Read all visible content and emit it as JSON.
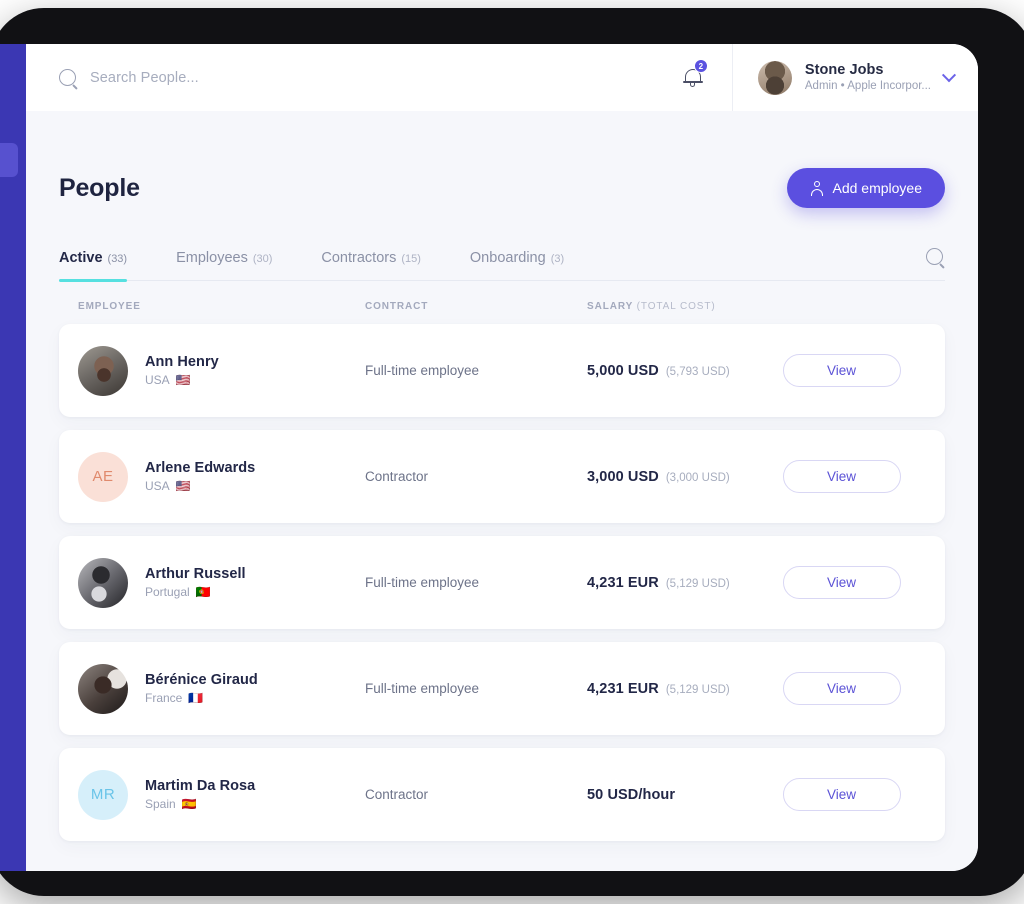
{
  "topbar": {
    "search": {
      "placeholder": "Search People...",
      "value": "",
      "icon": "search-icon"
    },
    "notifications": {
      "icon": "bell-icon",
      "badge": "2"
    },
    "user": {
      "name": "Stone Jobs",
      "subtitle": "Admin  •  Apple Incorpor...",
      "avatar": "user-avatar",
      "chevron": "chevron-down-icon"
    }
  },
  "page": {
    "title": "People",
    "add_employee_label": "Add employee",
    "add_employee_icon": "person-add-icon",
    "accent_purple": "#5b4fe0",
    "accent_teal": "#56e0e0"
  },
  "tabs": {
    "search_icon": "search-icon",
    "items": [
      {
        "label": "Active",
        "count": "(33)",
        "active": true
      },
      {
        "label": "Employees",
        "count": "(30)",
        "active": false
      },
      {
        "label": "Contractors",
        "count": "(15)",
        "active": false
      },
      {
        "label": "Onboarding",
        "count": "(3)",
        "active": false
      }
    ]
  },
  "table": {
    "headers": {
      "employee": "EMPLOYEE",
      "contract": "CONTRACT",
      "salary": "SALARY",
      "salary_sub": "(TOTAL COST)"
    },
    "action_label": "View",
    "rows": [
      {
        "name": "Ann Henry",
        "country": "USA",
        "flag": "🇺🇸",
        "avatar_kind": "photo",
        "avatar_class": "photo-1",
        "initials": "",
        "contract": "Full-time employee",
        "salary": "5,000 USD",
        "total_cost": "(5,793 USD)",
        "action": "View"
      },
      {
        "name": "Arlene Edwards",
        "country": "USA",
        "flag": "🇺🇸",
        "avatar_kind": "initials",
        "avatar_class": "",
        "initials": "AE",
        "avatar_bg": "#fae0d7",
        "avatar_fg": "#e08a6d",
        "contract": "Contractor",
        "salary": "3,000 USD",
        "total_cost": "(3,000 USD)",
        "action": "View"
      },
      {
        "name": "Arthur Russell",
        "country": "Portugal",
        "flag": "🇵🇹",
        "avatar_kind": "photo",
        "avatar_class": "photo-3",
        "initials": "",
        "contract": "Full-time employee",
        "salary": "4,231 EUR",
        "total_cost": "(5,129 USD)",
        "action": "View"
      },
      {
        "name": "Bérénice Giraud",
        "country": "France",
        "flag": "🇫🇷",
        "avatar_kind": "photo",
        "avatar_class": "photo-4",
        "initials": "",
        "contract": "Full-time employee",
        "salary": "4,231 EUR",
        "total_cost": "(5,129 USD)",
        "action": "View"
      },
      {
        "name": "Martim Da Rosa",
        "country": "Spain",
        "flag": "🇪🇸",
        "avatar_kind": "initials",
        "avatar_class": "",
        "initials": "MR",
        "avatar_bg": "#d6effa",
        "avatar_fg": "#6ac4e8",
        "contract": "Contractor",
        "salary": "50 USD/hour",
        "total_cost": "",
        "action": "View"
      }
    ]
  }
}
